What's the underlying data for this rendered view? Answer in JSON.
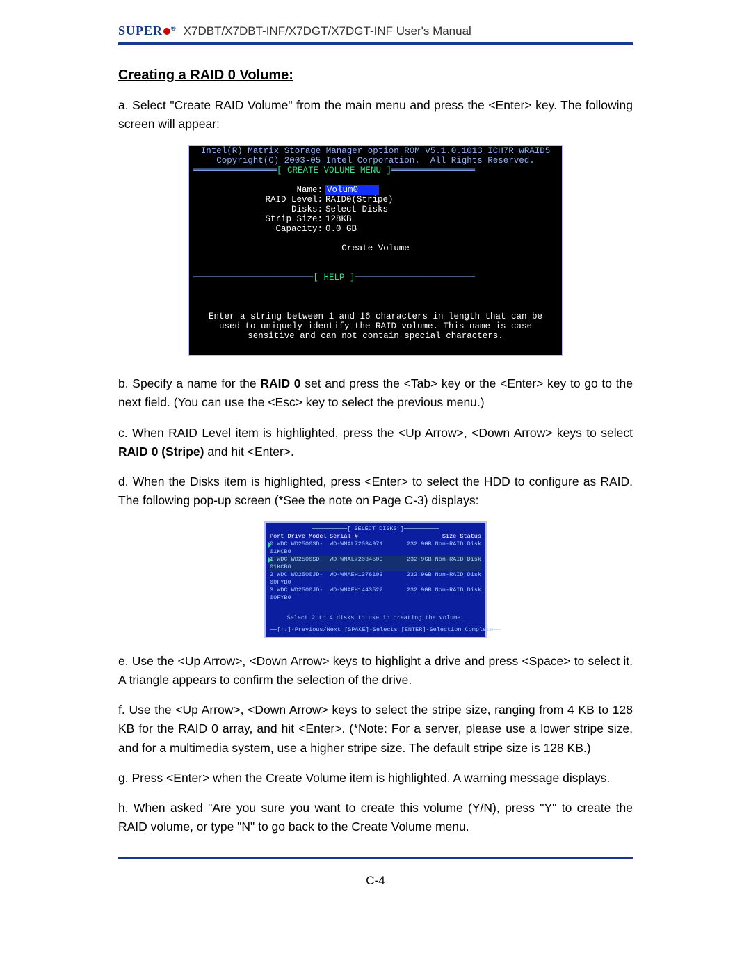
{
  "header": {
    "logo_text": "SUPER",
    "doc_title": " X7DBT/X7DBT-INF/X7DGT/X7DGT-INF User's Manual"
  },
  "section_title": "Creating a RAID 0 Volume:",
  "para_a": "a. Select \"Create RAID Volume\" from the main menu and press the <Enter> key. The following screen will appear:",
  "bios1": {
    "line1": "Intel(R) Matrix Storage Manager option ROM v5.1.0.1013 ICH7R wRAID5",
    "line2": "Copyright(C) 2003-05 Intel Corporation.  All Rights Reserved.",
    "menu_title": "[ CREATE VOLUME MENU ]",
    "fields": {
      "name_label": "Name:",
      "name_value": "Volum0",
      "raid_label": "RAID Level:",
      "raid_value": "RAID0(Stripe)",
      "disks_label": "Disks:",
      "disks_value": "Select Disks",
      "strip_label": "Strip Size:",
      "strip_value": " 128KB",
      "cap_label": "Capacity:",
      "cap_value": "0.0   GB"
    },
    "create_volume": "Create Volume",
    "help_title": "[ HELP ]",
    "help_text": "Enter a string between 1 and 16 characters in length that can be used to uniquely identify the RAID volume. This name is case sensitive and can not contain special characters."
  },
  "para_b_pre": "b. Specify a name for the ",
  "para_b_bold": "RAID 0",
  "para_b_post": " set and press the <Tab> key or the <Enter> key to go to the next field. (You can use the <Esc> key to select the previous menu.)",
  "para_c_pre": "c. When RAID Level item is highlighted, press the <Up Arrow>, <Down Arrow> keys to select ",
  "para_c_bold": "RAID 0 (Stripe)",
  "para_c_post": " and hit <Enter>.",
  "para_d": "d. When the Disks item is highlighted, press <Enter> to select the HDD to configure as RAID.  The following pop-up screen (*See the note on Page C-3) displays:",
  "bios2": {
    "title": "[ SELECT DISKS ]",
    "header": {
      "c1": "Port Drive Model",
      "c2": "Serial #",
      "c3": "Size Status"
    },
    "rows": [
      {
        "c1": "0 WDC WD2500SD-01KCB0",
        "c2": "WD-WMAL72034971",
        "c3": "232.9GB Non-RAID Disk"
      },
      {
        "c1": "1 WDC WD2500SD-01KCB0",
        "c2": "WD-WMAL72034509",
        "c3": "232.9GB Non-RAID Disk"
      },
      {
        "c1": "2 WDC WD2500JD-00FYB0",
        "c2": "WD-WMAEH1376103",
        "c3": "232.9GB Non-RAID Disk"
      },
      {
        "c1": "3 WDC WD2500JD-00FYB0",
        "c2": "WD-WMAEH1443527",
        "c3": "232.9GB Non-RAID Disk"
      }
    ],
    "hint": "Select 2 to 4 disks to use in creating the volume.",
    "footer": "[↑↓]-Previous/Next  [SPACE]-Selects  [ENTER]-Selection Complete"
  },
  "para_e": "e. Use  the <Up Arrow>, <Down Arrow> keys to highlight a drive and press <Space> to select it. A triangle appears to confirm the selection of the drive.",
  "para_f": "f. Use  the <Up Arrow>, <Down Arrow> keys to select the stripe size, ranging from 4 KB to 128 KB for the RAID 0 array, and hit <Enter>. (*Note: For a server, please use a lower stripe size, and for a multimedia system, use a higher stripe size. The default stripe size is 128 KB.)",
  "para_g": "g. Press <Enter> when the Create Volume item is highlighted. A warning message displays.",
  "para_h": "h. When asked \"Are you sure you want to create this volume (Y/N), press \"Y\" to create the RAID volume, or type \"N\" to go back to the Create Volume menu.",
  "page_number": "C-4"
}
